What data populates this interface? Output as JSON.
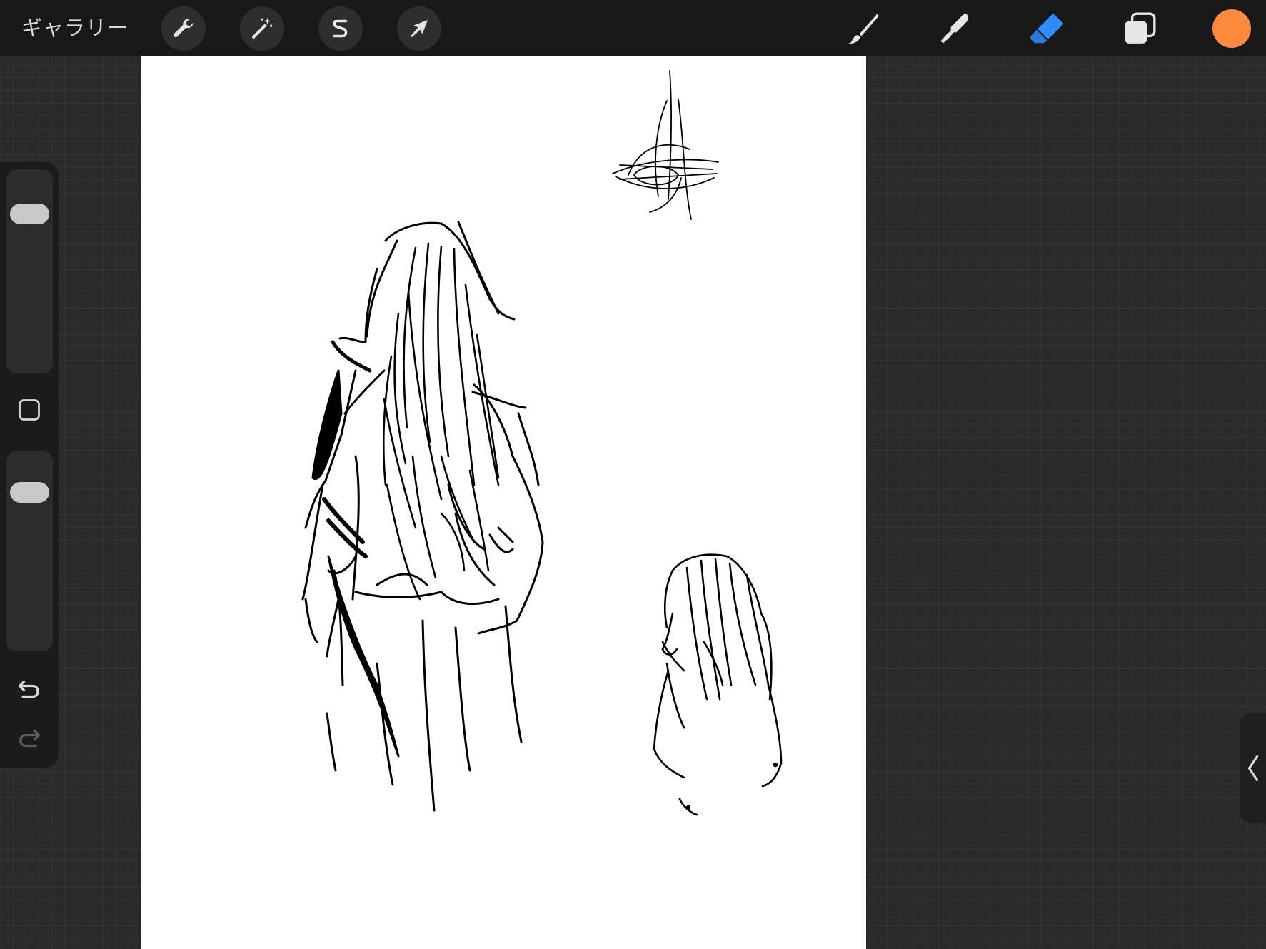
{
  "topbar": {
    "gallery_label": "ギャラリー",
    "left_tools": [
      {
        "name": "actions",
        "icon": "wrench-icon"
      },
      {
        "name": "adjustments",
        "icon": "magic-wand-icon"
      },
      {
        "name": "selection",
        "icon": "selection-s-icon"
      },
      {
        "name": "transform",
        "icon": "arrow-cursor-icon"
      }
    ],
    "right_tools": [
      {
        "name": "brush",
        "icon": "brush-icon",
        "active": false
      },
      {
        "name": "smudge",
        "icon": "smudge-finger-icon",
        "active": false
      },
      {
        "name": "eraser",
        "icon": "eraser-icon",
        "active": true
      },
      {
        "name": "layers",
        "icon": "layers-icon",
        "active": false
      }
    ],
    "current_color": "#ff8a3d"
  },
  "sidebar": {
    "size_slider_icon": "slider-thumb",
    "modify_button_icon": "square-icon",
    "opacity_slider_icon": "slider-thumb",
    "undo_icon": "undo-arrow-icon",
    "redo_icon": "redo-arrow-icon"
  },
  "colors": {
    "accent_active": "#2e8cff",
    "swatch": "#ff8a3d"
  },
  "side_tab_icon": "chevron-left-icon"
}
